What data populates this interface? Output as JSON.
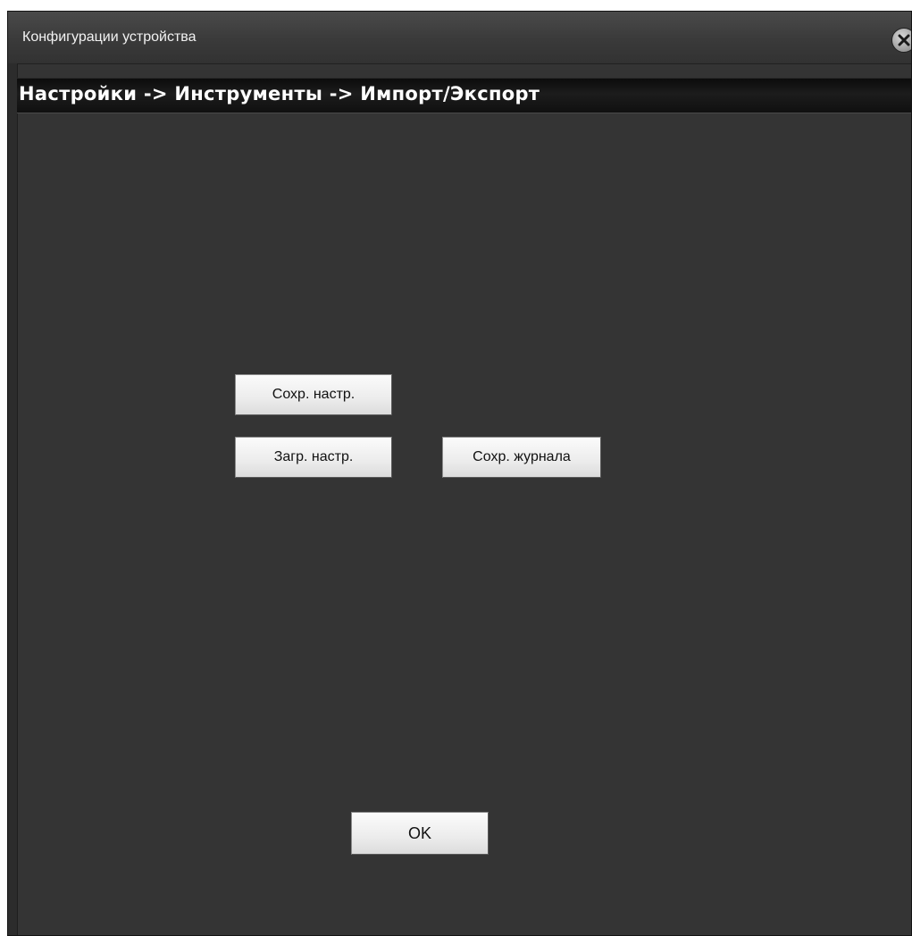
{
  "window": {
    "title": "Конфигурации устройства",
    "close_icon": "close-icon"
  },
  "breadcrumb": {
    "text": "Настройки -> Инструменты -> Импорт/Экспорт"
  },
  "actions": {
    "save_settings": "Сохр. настр.",
    "load_settings": "Загр. настр.",
    "save_log": "Сохр. журнала",
    "ok": "OK"
  },
  "colors": {
    "panel_background": "#343434",
    "breadcrumb_background": "#111111",
    "button_background": "#ececec",
    "text_light": "#ffffff"
  }
}
